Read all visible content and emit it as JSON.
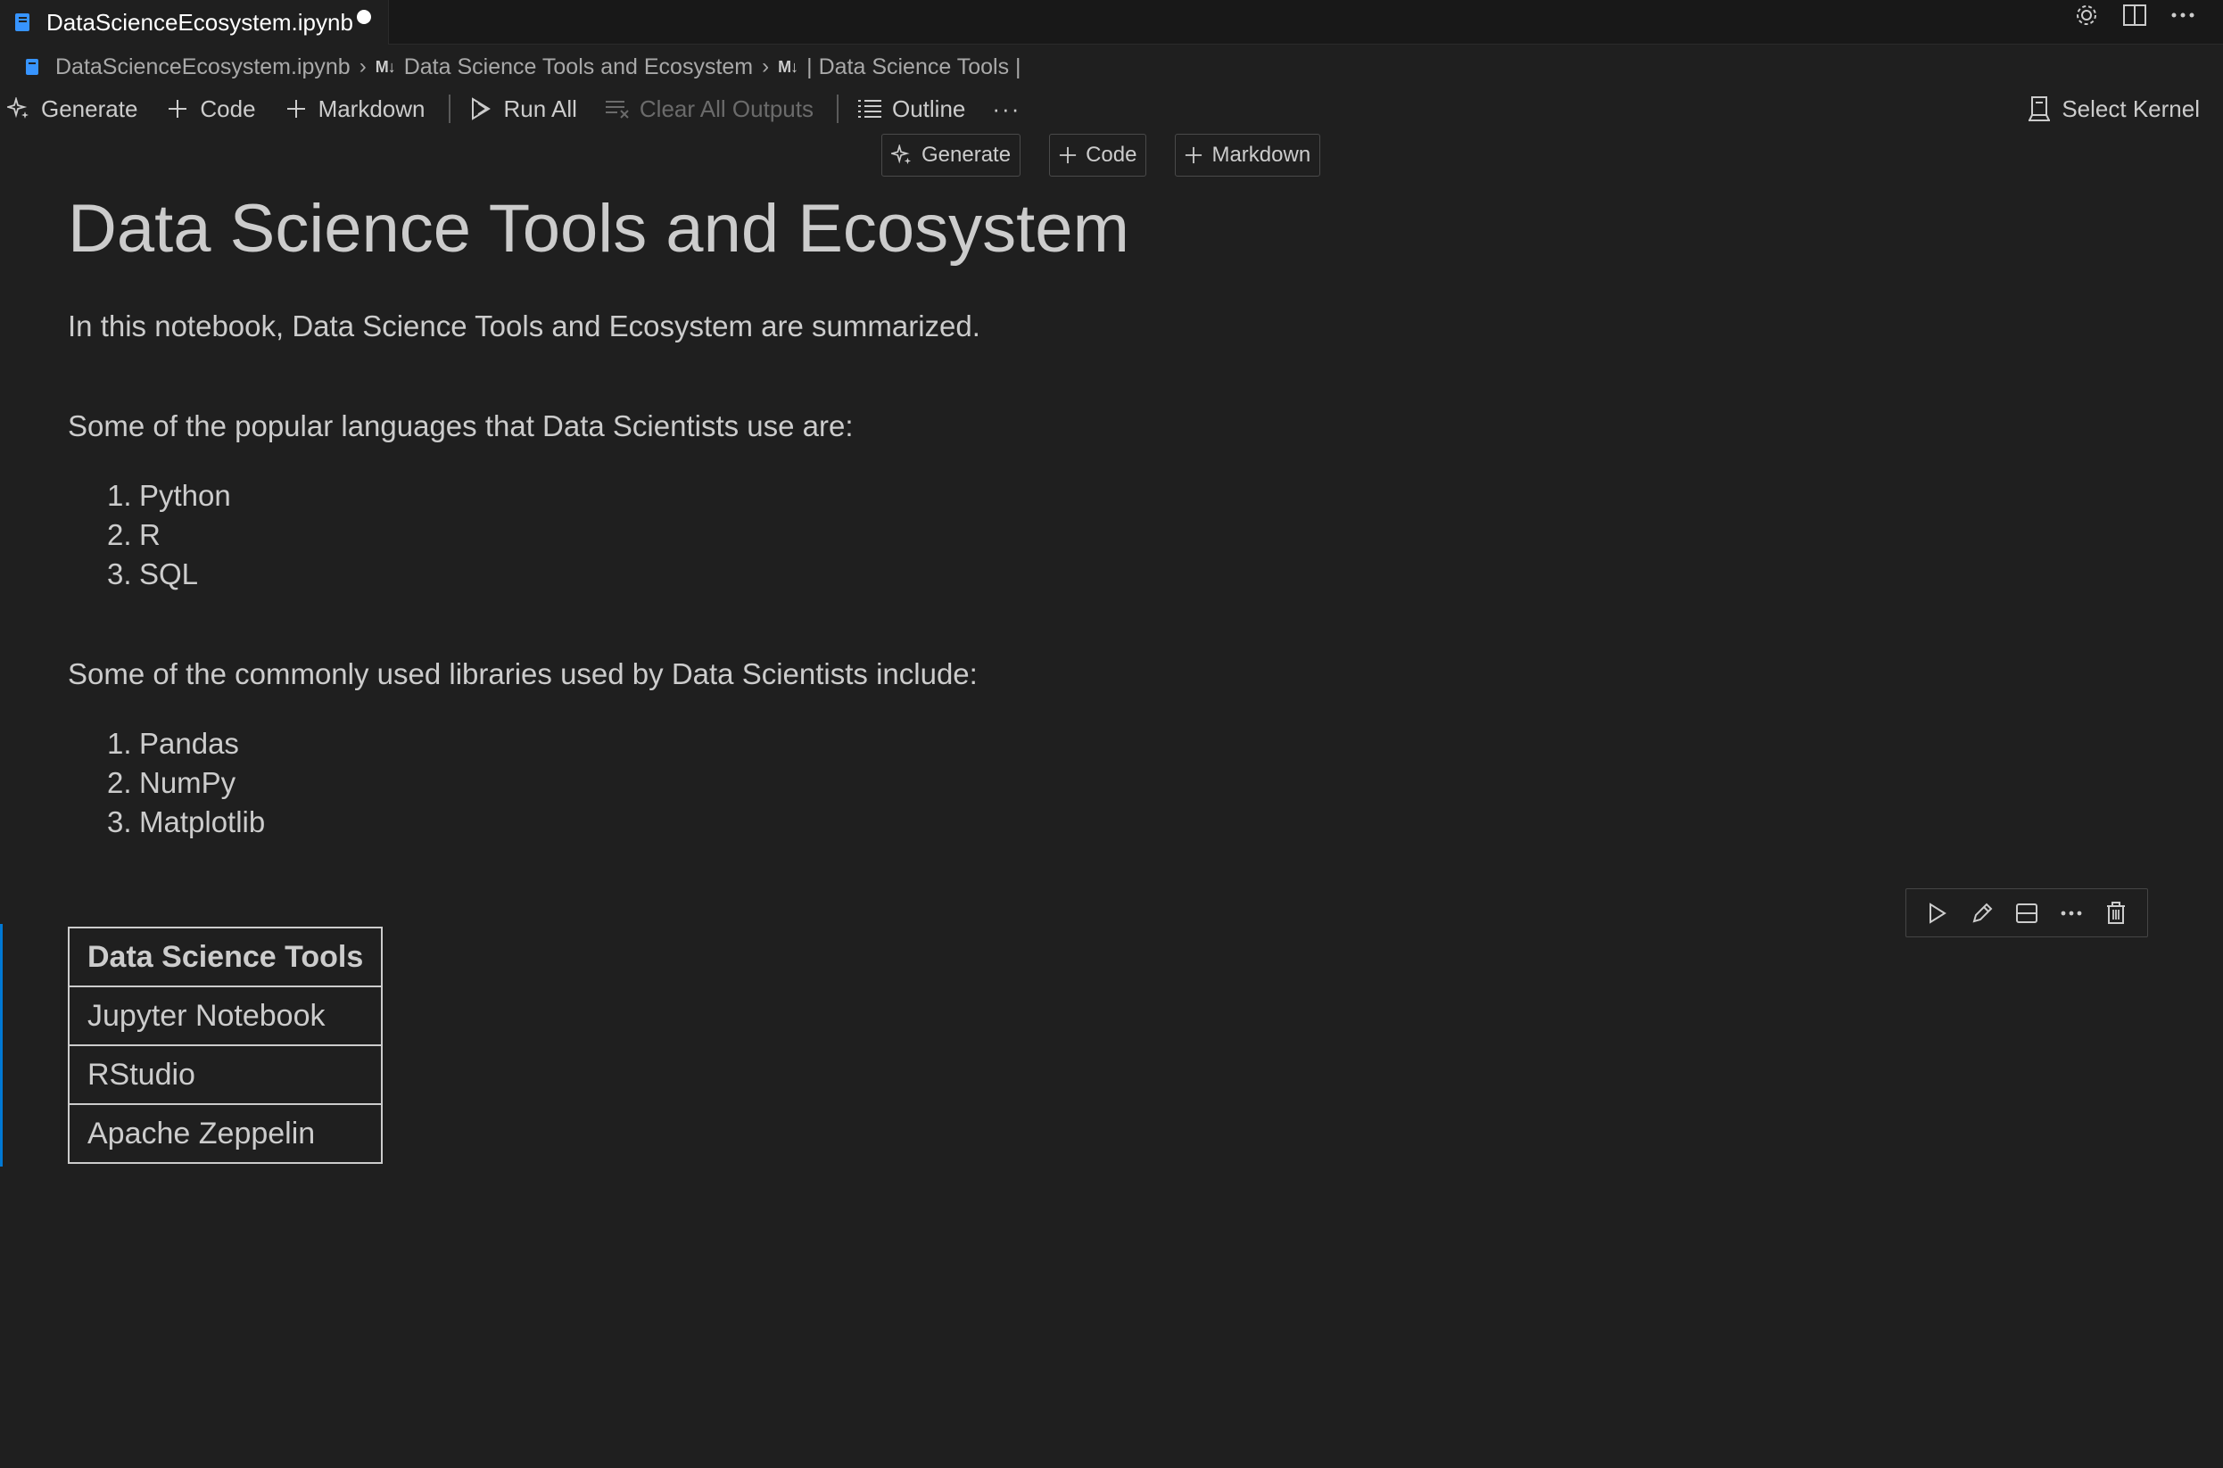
{
  "tab": {
    "title": "DataScienceEcosystem.ipynb",
    "icon": "notebook-icon",
    "dirty": true
  },
  "title_actions": [
    "gear-icon",
    "split-editor-icon",
    "more-icon"
  ],
  "breadcrumb": {
    "file": "DataScienceEcosystem.ipynb",
    "md_badge_1": "M↓",
    "section": "Data Science Tools and Ecosystem",
    "md_badge_2": "M↓",
    "cell": "| Data Science Tools |"
  },
  "toolbar": {
    "generate": "Generate",
    "code": "Code",
    "markdown": "Markdown",
    "run_all": "Run All",
    "clear_outputs": "Clear All Outputs",
    "outline": "Outline",
    "more": "···",
    "select_kernel": "Select Kernel"
  },
  "insert": {
    "generate": "Generate",
    "code": "Code",
    "markdown": "Markdown"
  },
  "notebook": {
    "heading": "Data Science Tools and Ecosystem",
    "intro": "In this notebook, Data Science Tools and Ecosystem are summarized.",
    "languages_intro": "Some of the popular languages that Data Scientists use are:",
    "languages": [
      {
        "num": "1.",
        "text": "Python"
      },
      {
        "num": "2.",
        "text": "R"
      },
      {
        "num": "3.",
        "text": "SQL"
      }
    ],
    "libraries_intro": "Some of the commonly used libraries used by Data Scientists include:",
    "libraries": [
      {
        "num": "1.",
        "text": "Pandas"
      },
      {
        "num": "2.",
        "text": "NumPy"
      },
      {
        "num": "3.",
        "text": "Matplotlib"
      }
    ],
    "table": {
      "header": "Data Science Tools",
      "rows": [
        "Jupyter Notebook",
        "RStudio",
        "Apache Zeppelin"
      ]
    }
  },
  "colors": {
    "accent": "#0078d4",
    "background": "#1f1f1f",
    "text": "#cccccc"
  }
}
